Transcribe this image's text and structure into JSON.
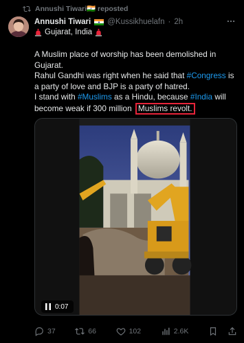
{
  "repost": {
    "text": "Annushi Tiwari🇮🇳 reposted"
  },
  "author": {
    "name": "Annushi Tiwari",
    "handle": "@Kussikhuelafn",
    "separator": "·",
    "time": "2h"
  },
  "location": {
    "text": "Gujarat, India"
  },
  "tweet": {
    "line1": "A Muslim place of worship has been demolished in Gujarat.",
    "line2_pre": "Rahul Gandhi was right when he said that ",
    "line2_tag": "#Congress",
    "line2_post": " is a party of love and BJP is a party of hatred.",
    "line3_pre": "I stand with ",
    "line3_tag1": "#Muslims",
    "line3_mid": " as a Hindu, because ",
    "line3_tag2": "#India",
    "line3_post": " will become weak if 300 million ",
    "line3_highlight": "Muslims revolt."
  },
  "video": {
    "time": "0:07"
  },
  "actions": {
    "replies": "37",
    "reposts": "66",
    "likes": "102",
    "views": "2.6K"
  },
  "colors": {
    "accent": "#1d9bf0",
    "highlight_border": "#e8243a",
    "muted": "#71767b"
  }
}
